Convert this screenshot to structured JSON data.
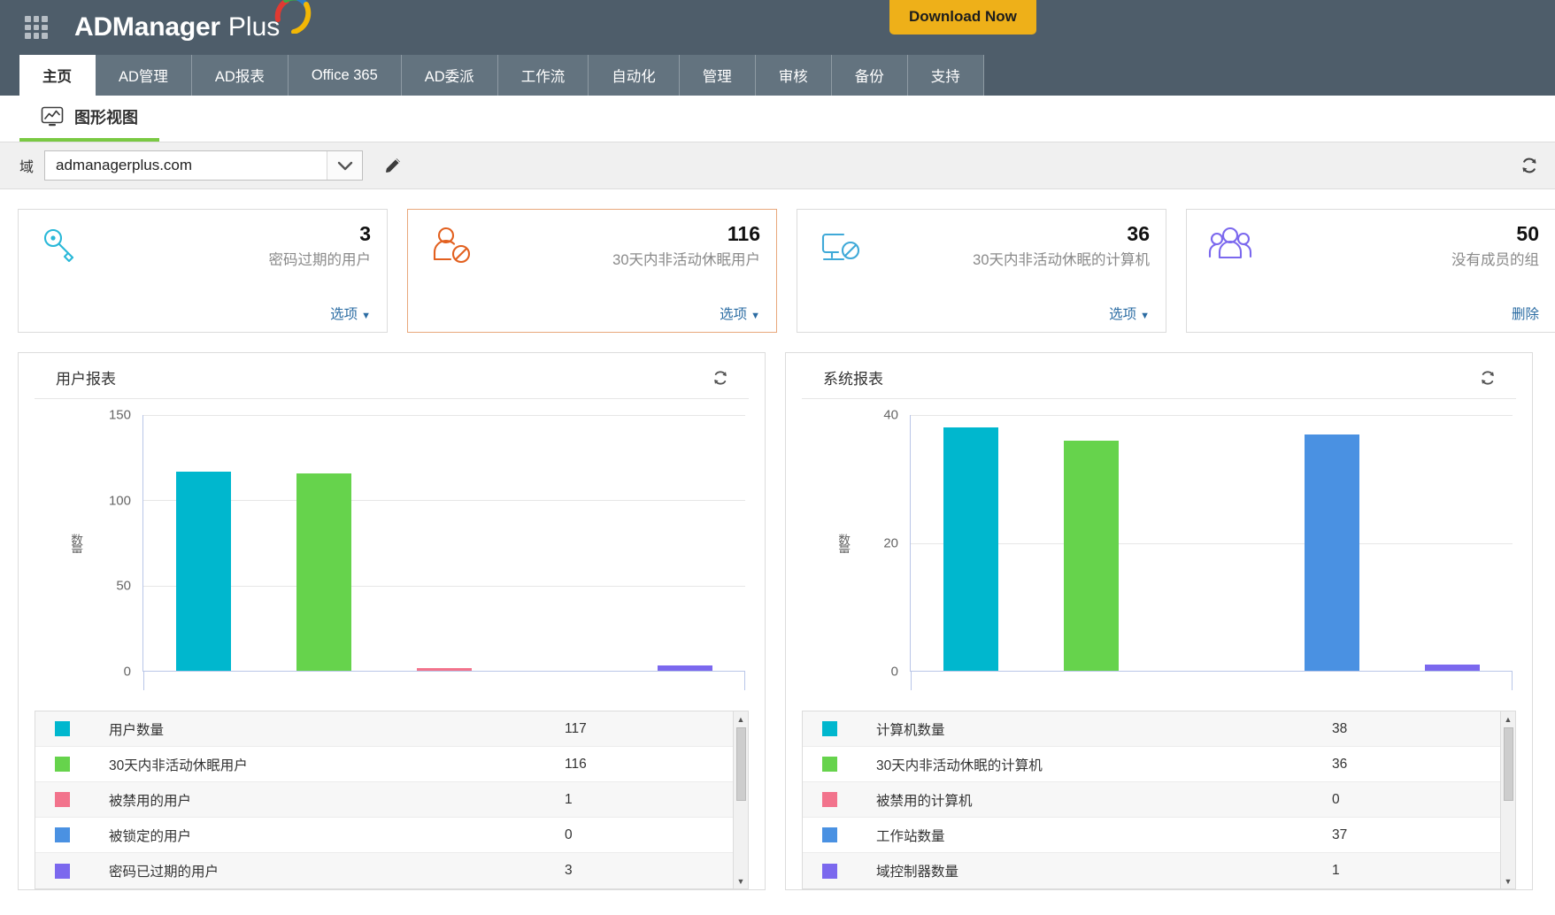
{
  "header": {
    "brand_ad": "ADManager",
    "brand_plus": "Plus",
    "download_label": "Download Now"
  },
  "tabs": [
    {
      "label": "主页",
      "active": true
    },
    {
      "label": "AD管理",
      "active": false
    },
    {
      "label": "AD报表",
      "active": false
    },
    {
      "label": "Office 365",
      "active": false
    },
    {
      "label": "AD委派",
      "active": false
    },
    {
      "label": "工作流",
      "active": false
    },
    {
      "label": "自动化",
      "active": false
    },
    {
      "label": "管理",
      "active": false
    },
    {
      "label": "审核",
      "active": false
    },
    {
      "label": "备份",
      "active": false
    },
    {
      "label": "支持",
      "active": false
    }
  ],
  "subtab": {
    "label": "图形视图"
  },
  "domain": {
    "label": "域",
    "value": "admanagerplus.com"
  },
  "cards": [
    {
      "value": "3",
      "label": "密码过期的用户",
      "action": "选项",
      "has_caret": true,
      "icon": "key-icon",
      "color": "#29b8d8",
      "highlight": false
    },
    {
      "value": "116",
      "label": "30天内非活动休眠用户",
      "action": "选项",
      "has_caret": true,
      "icon": "user-disabled-icon",
      "color": "#e2601f",
      "highlight": true
    },
    {
      "value": "36",
      "label": "30天内非活动休眠的计算机",
      "action": "选项",
      "has_caret": true,
      "icon": "computer-disabled-icon",
      "color": "#3fa9d8",
      "highlight": false
    },
    {
      "value": "50",
      "label": "没有成员的组",
      "action": "删除",
      "has_caret": false,
      "icon": "group-icon",
      "color": "#7b68ee",
      "highlight": false
    }
  ],
  "chart_data": [
    {
      "type": "bar",
      "title": "用户报表",
      "panel_id": "user-report",
      "xlabel": "",
      "ylabel": "数量",
      "ylim": [
        0,
        150
      ],
      "yticks": [
        0,
        50,
        100,
        150
      ],
      "grid": true,
      "categories": [
        "用户数量",
        "30天内非活动休眠用户",
        "被禁用的用户",
        "被锁定的用户",
        "密码已过期的用户"
      ],
      "values": [
        117,
        116,
        1,
        0,
        3
      ],
      "colors": [
        "#00b7ce",
        "#66d34c",
        "#f2738c",
        "#4a91e2",
        "#7b68ee"
      ]
    },
    {
      "type": "bar",
      "title": "系统报表",
      "panel_id": "system-report",
      "xlabel": "",
      "ylabel": "数量",
      "ylim": [
        0,
        40
      ],
      "yticks": [
        0,
        20,
        40
      ],
      "grid": true,
      "categories": [
        "计算机数量",
        "30天内非活动休眠的计算机",
        "被禁用的计算机",
        "工作站数量",
        "域控制器数量"
      ],
      "values": [
        38,
        36,
        0,
        37,
        1
      ],
      "colors": [
        "#00b7ce",
        "#66d34c",
        "#f2738c",
        "#4a91e2",
        "#7b68ee"
      ]
    }
  ],
  "legends": [
    {
      "panel_id": "user-report",
      "rows": [
        {
          "color": "#00b7ce",
          "name": "用户数量",
          "value": "117"
        },
        {
          "color": "#66d34c",
          "name": "30天内非活动休眠用户",
          "value": "116"
        },
        {
          "color": "#f2738c",
          "name": "被禁用的用户",
          "value": "1"
        },
        {
          "color": "#4a91e2",
          "name": "被锁定的用户",
          "value": "0"
        },
        {
          "color": "#7b68ee",
          "name": "密码已过期的用户",
          "value": "3"
        }
      ]
    },
    {
      "panel_id": "system-report",
      "rows": [
        {
          "color": "#00b7ce",
          "name": "计算机数量",
          "value": "38"
        },
        {
          "color": "#66d34c",
          "name": "30天内非活动休眠的计算机",
          "value": "36"
        },
        {
          "color": "#f2738c",
          "name": "被禁用的计算机",
          "value": "0"
        },
        {
          "color": "#4a91e2",
          "name": "工作站数量",
          "value": "37"
        },
        {
          "color": "#7b68ee",
          "name": "域控制器数量",
          "value": "1"
        }
      ]
    }
  ]
}
